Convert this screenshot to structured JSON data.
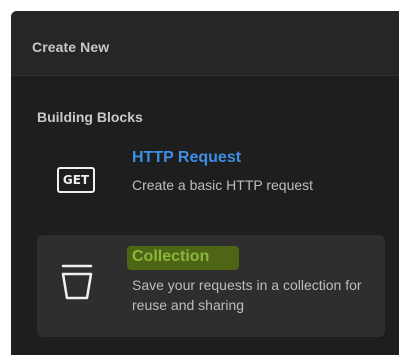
{
  "header": {
    "title": "Create New"
  },
  "section": {
    "title": "Building Blocks"
  },
  "items": [
    {
      "icon": "get-icon",
      "icon_text": "GET",
      "title": "HTTP Request",
      "description": "Create a basic HTTP request"
    },
    {
      "icon": "trash-bin-icon",
      "title": "Collection",
      "description": "Save your requests in a collection for reuse and sharing"
    }
  ],
  "colors": {
    "background": "#1e1e1e",
    "header_background": "#262626",
    "selected_item_background": "#2e2e2e",
    "http_title": "#3d8fe6",
    "collection_title": "#8db63c",
    "highlight": "#556e12"
  }
}
